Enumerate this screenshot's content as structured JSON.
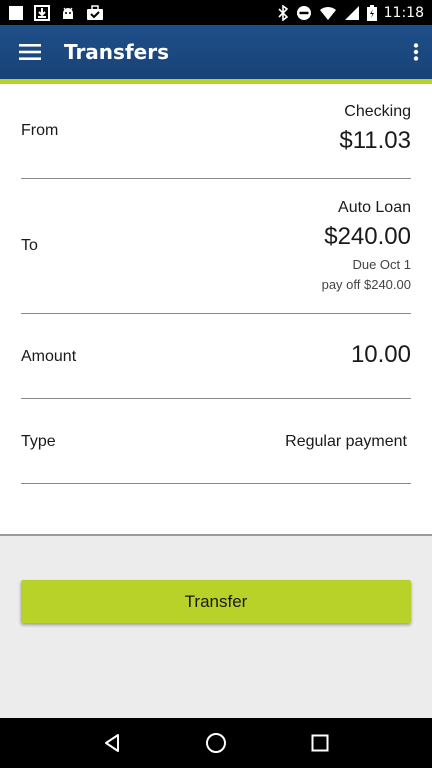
{
  "status_bar": {
    "time": "11:18",
    "icons_left": [
      "notification-square-icon",
      "download-icon",
      "android-icon",
      "briefcase-check-icon"
    ],
    "icons_right": [
      "bluetooth-icon",
      "do-not-disturb-icon",
      "wifi-icon",
      "cellular-signal-icon",
      "battery-charging-icon"
    ]
  },
  "app_bar": {
    "title": "Transfers",
    "menu_icon": "hamburger-menu-icon",
    "overflow_icon": "more-vert-icon",
    "color": "#1f4f8a",
    "accent": "#b9d22a"
  },
  "form": {
    "from": {
      "label": "From",
      "account": "Checking",
      "amount": "$11.03"
    },
    "to": {
      "label": "To",
      "account": "Auto Loan",
      "amount": "$240.00",
      "due": "Due Oct 1",
      "payoff": "pay off $240.00"
    },
    "amount": {
      "label": "Amount",
      "value": "10.00"
    },
    "type": {
      "label": "Type",
      "value": "Regular payment"
    }
  },
  "actions": {
    "transfer_label": "Transfer"
  },
  "nav_bar": {
    "icons": [
      "back-triangle-icon",
      "home-circle-icon",
      "recents-square-icon"
    ]
  }
}
